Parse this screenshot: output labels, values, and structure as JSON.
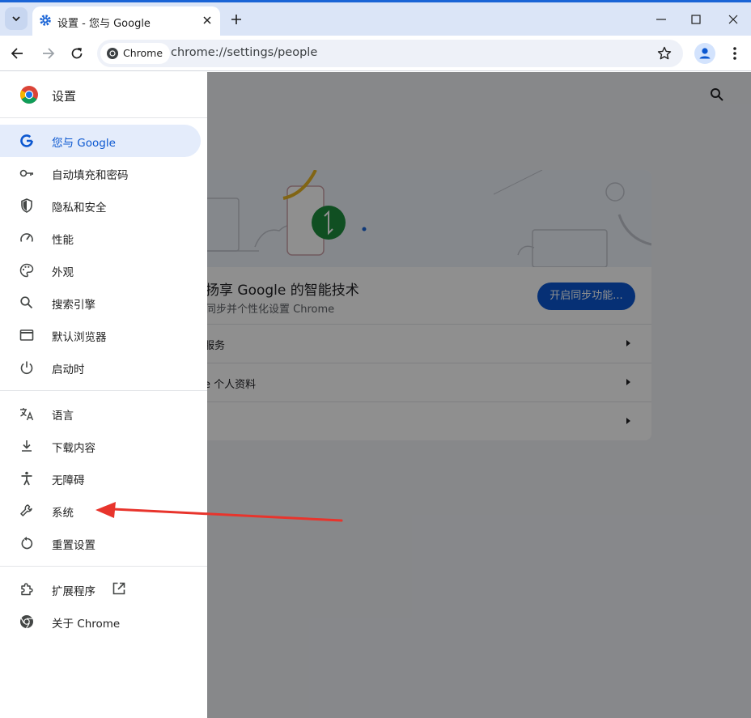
{
  "browser": {
    "tab": {
      "title": "设置 - 您与 Google"
    },
    "omnibox": {
      "chip_label": "Chrome",
      "url": "chrome://settings/people"
    }
  },
  "sidebar": {
    "title": "设置",
    "items": [
      {
        "label": "您与 Google",
        "icon": "google-g-icon",
        "selected": true
      },
      {
        "label": "自动填充和密码",
        "icon": "key-icon"
      },
      {
        "label": "隐私和安全",
        "icon": "shield-icon"
      },
      {
        "label": "性能",
        "icon": "speedometer-icon"
      },
      {
        "label": "外观",
        "icon": "palette-icon"
      },
      {
        "label": "搜索引擎",
        "icon": "search-icon"
      },
      {
        "label": "默认浏览器",
        "icon": "browser-window-icon"
      },
      {
        "label": "启动时",
        "icon": "power-icon"
      },
      {
        "label": "语言",
        "icon": "translate-icon"
      },
      {
        "label": "下载内容",
        "icon": "download-icon"
      },
      {
        "label": "无障碍",
        "icon": "accessibility-icon"
      },
      {
        "label": "系统",
        "icon": "wrench-icon"
      },
      {
        "label": "重置设置",
        "icon": "reset-icon"
      },
      {
        "label": "扩展程序",
        "icon": "extension-icon"
      },
      {
        "label": "关于 Chrome",
        "icon": "chrome-icon"
      }
    ]
  },
  "card": {
    "heading": "扬享 Google 的智能技术",
    "subtitle": "同步并个性化设置 Chrome",
    "sync_button": "开启同步功能...",
    "rows": [
      "服务",
      "e 个人资料",
      ""
    ]
  },
  "colors": {
    "accent": "#0b57d0",
    "selected_bg": "#e4ecfb",
    "annotation": "#e8342c"
  }
}
